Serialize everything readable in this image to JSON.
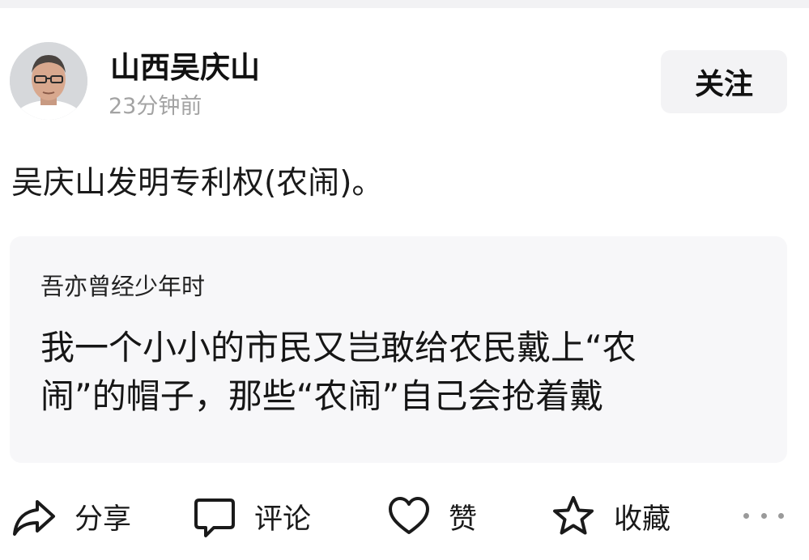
{
  "author": {
    "name": "山西吴庆山",
    "time": "23分钟前",
    "follow_label": "关注"
  },
  "post": {
    "text": "吴庆山发明专利权(农闹)。"
  },
  "quote": {
    "title": "吾亦曾经少年时",
    "lines": [
      "我一个小小的市民又岂敢给农民戴上“农",
      "闹”的帽子，那些“农闹”自己会抢着戴"
    ]
  },
  "actions": [
    {
      "label": "分享",
      "icon": "share-icon"
    },
    {
      "label": "评论",
      "icon": "comment-icon"
    },
    {
      "label": "赞",
      "icon": "like-icon"
    },
    {
      "label": "收藏",
      "icon": "star-icon"
    }
  ],
  "more_icon": "more-icon",
  "colors": {
    "background": "#ffffff",
    "card_background": "#f7f7f9",
    "button_background": "#f3f3f5",
    "muted_text": "#a3a3a3",
    "primary_text": "#1a1a1a"
  }
}
